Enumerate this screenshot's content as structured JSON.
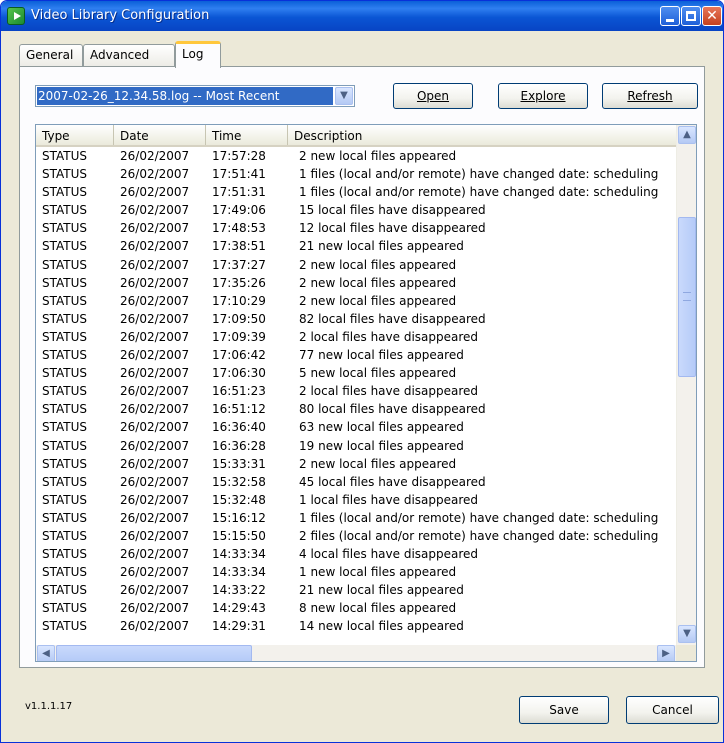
{
  "window": {
    "title": "Video Library Configuration"
  },
  "tabs": [
    {
      "label": "General"
    },
    {
      "label": "Advanced"
    },
    {
      "label": "Log"
    }
  ],
  "log_select": {
    "value": "2007-02-26_12.34.58.log -- Most Recent"
  },
  "toolbar": {
    "open_label": "Open",
    "explore_label": "Explore",
    "refresh_label": "Refresh"
  },
  "log_table": {
    "columns": [
      "Type",
      "Date",
      "Time",
      "Description"
    ],
    "rows": [
      [
        "STATUS",
        "26/02/2007",
        "17:57:28",
        "2 new local files appeared"
      ],
      [
        "STATUS",
        "26/02/2007",
        "17:51:41",
        "1 files (local and/or remote) have changed date: scheduling"
      ],
      [
        "STATUS",
        "26/02/2007",
        "17:51:31",
        "1 files (local and/or remote) have changed date: scheduling"
      ],
      [
        "STATUS",
        "26/02/2007",
        "17:49:06",
        "15 local files have disappeared"
      ],
      [
        "STATUS",
        "26/02/2007",
        "17:48:53",
        "12 local files have disappeared"
      ],
      [
        "STATUS",
        "26/02/2007",
        "17:38:51",
        "21 new local files appeared"
      ],
      [
        "STATUS",
        "26/02/2007",
        "17:37:27",
        "2 new local files appeared"
      ],
      [
        "STATUS",
        "26/02/2007",
        "17:35:26",
        "2 new local files appeared"
      ],
      [
        "STATUS",
        "26/02/2007",
        "17:10:29",
        "2 new local files appeared"
      ],
      [
        "STATUS",
        "26/02/2007",
        "17:09:50",
        "82 local files have disappeared"
      ],
      [
        "STATUS",
        "26/02/2007",
        "17:09:39",
        "2 local files have disappeared"
      ],
      [
        "STATUS",
        "26/02/2007",
        "17:06:42",
        "77 new local files appeared"
      ],
      [
        "STATUS",
        "26/02/2007",
        "17:06:30",
        "5 new local files appeared"
      ],
      [
        "STATUS",
        "26/02/2007",
        "16:51:23",
        "2 local files have disappeared"
      ],
      [
        "STATUS",
        "26/02/2007",
        "16:51:12",
        "80 local files have disappeared"
      ],
      [
        "STATUS",
        "26/02/2007",
        "16:36:40",
        "63 new local files appeared"
      ],
      [
        "STATUS",
        "26/02/2007",
        "16:36:28",
        "19 new local files appeared"
      ],
      [
        "STATUS",
        "26/02/2007",
        "15:33:31",
        "2 new local files appeared"
      ],
      [
        "STATUS",
        "26/02/2007",
        "15:32:58",
        "45 local files have disappeared"
      ],
      [
        "STATUS",
        "26/02/2007",
        "15:32:48",
        "1 local files have disappeared"
      ],
      [
        "STATUS",
        "26/02/2007",
        "15:16:12",
        "1 files (local and/or remote) have changed date: scheduling"
      ],
      [
        "STATUS",
        "26/02/2007",
        "15:15:50",
        "2 files (local and/or remote) have changed date: scheduling"
      ],
      [
        "STATUS",
        "26/02/2007",
        "14:33:34",
        "4 local files have disappeared"
      ],
      [
        "STATUS",
        "26/02/2007",
        "14:33:34",
        "1 new local files appeared"
      ],
      [
        "STATUS",
        "26/02/2007",
        "14:33:22",
        "21 new local files appeared"
      ],
      [
        "STATUS",
        "26/02/2007",
        "14:29:43",
        "8 new local files appeared"
      ],
      [
        "STATUS",
        "26/02/2007",
        "14:29:31",
        "14 new local files appeared"
      ]
    ]
  },
  "footer": {
    "version": "v1.1.1.17",
    "save_label": "Save",
    "cancel_label": "Cancel"
  },
  "colors": {
    "title_bar": "#0a55d4",
    "selection": "#316ac5",
    "active_tab_accent": "#ffc73c",
    "dialog_bg": "#ece9d8"
  },
  "icons": {
    "app": "video-app-icon",
    "minimize": "minimize-icon",
    "maximize": "maximize-icon",
    "close": "close-icon",
    "dropdown": "chevron-down-icon",
    "scroll_up": "scroll-up-icon",
    "scroll_down": "scroll-down-icon",
    "scroll_left": "scroll-left-icon",
    "scroll_right": "scroll-right-icon"
  }
}
